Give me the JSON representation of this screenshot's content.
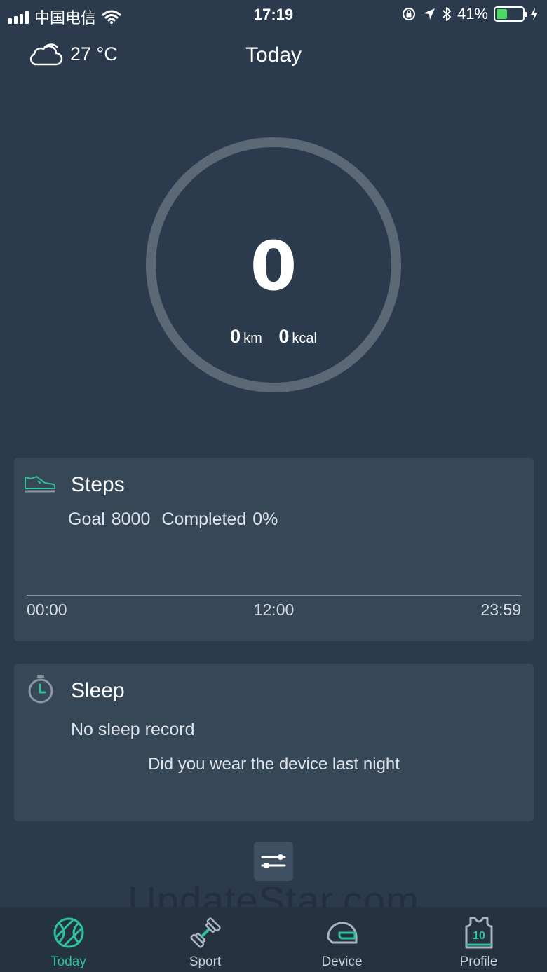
{
  "status_bar": {
    "carrier": "中国电信",
    "time": "17:19",
    "battery_percent_label": "41%",
    "battery_level": 0.41
  },
  "header": {
    "weather_icon": "cloud-icon",
    "temperature": "27 °C",
    "title": "Today"
  },
  "summary": {
    "steps": "0",
    "distance_value": "0",
    "distance_unit": "km",
    "calories_value": "0",
    "calories_unit": "kcal"
  },
  "steps_card": {
    "icon": "shoe-icon",
    "title": "Steps",
    "goal": "Goal 8000",
    "completed": "Completed 0%",
    "axis": {
      "start": "00:00",
      "mid": "12:00",
      "end": "23:59"
    }
  },
  "sleep_card": {
    "icon": "stopwatch-icon",
    "title": "Sleep",
    "empty_text": "No sleep record",
    "hint_text": "Did you wear the device last night"
  },
  "watermark": "UpdateStar.com",
  "tabs": [
    {
      "label": "Today",
      "icon": "basketball-icon",
      "active": true
    },
    {
      "label": "Sport",
      "icon": "dumbbell-icon",
      "active": false
    },
    {
      "label": "Device",
      "icon": "helmet-icon",
      "active": false
    },
    {
      "label": "Profile",
      "icon": "jersey-icon",
      "active": false,
      "badge": "10"
    }
  ],
  "colors": {
    "background": "#2b3a4c",
    "card": "#364758",
    "accent": "#2fc29a",
    "ring": "#5b6876",
    "tab_bar": "#25323f"
  }
}
